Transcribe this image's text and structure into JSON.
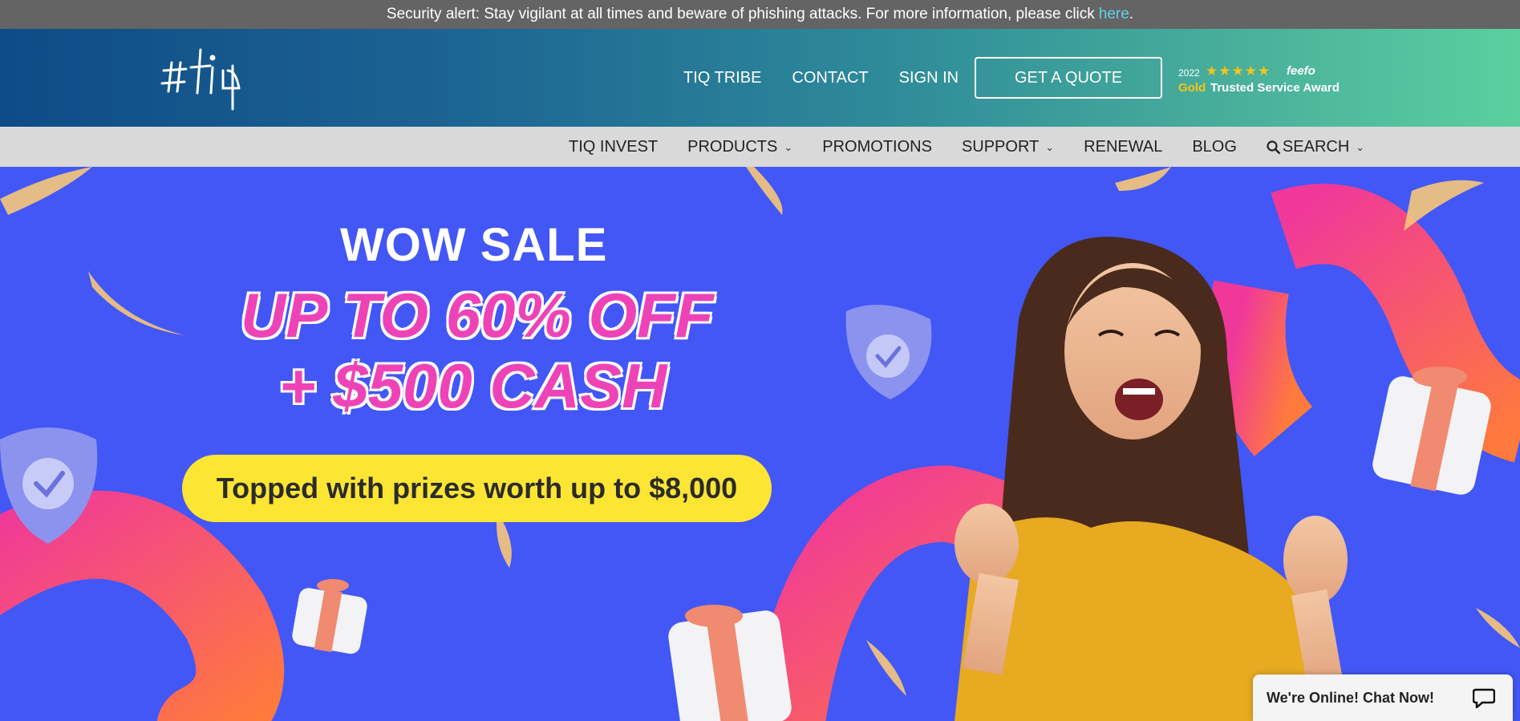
{
  "alert": {
    "text": "Security alert: Stay vigilant at all times and beware of phishing attacks. For more information, please click",
    "link": "here",
    "period": "."
  },
  "header": {
    "logo_text": "#tiq",
    "nav": [
      "TIQ TRIBE",
      "CONTACT",
      "SIGN IN"
    ],
    "quote_button": "GET A QUOTE",
    "award": {
      "year": "2022",
      "stars": "★★★★★",
      "brand": "feefo",
      "gold": "Gold",
      "label": "Trusted Service Award"
    }
  },
  "subnav": {
    "items": [
      {
        "label": "TIQ INVEST"
      },
      {
        "label": "PRODUCTS"
      },
      {
        "label": "PROMOTIONS"
      },
      {
        "label": "SUPPORT"
      },
      {
        "label": "RENEWAL"
      },
      {
        "label": "BLOG"
      },
      {
        "label": "SEARCH"
      }
    ]
  },
  "hero": {
    "headline": "WOW SALE",
    "offer_line1": "UP TO 60% OFF",
    "offer_line2": "+ $500 CASH",
    "prize_text": "Topped with prizes worth up to $8,000"
  },
  "chat": {
    "label": "We're Online! Chat Now!"
  },
  "colors": {
    "hero_bg": "#4257f5",
    "accent_pink": "#ee43b7",
    "prize_yellow": "#fde533",
    "alert_bg": "#646464",
    "link_cyan": "#5fd3e8"
  }
}
